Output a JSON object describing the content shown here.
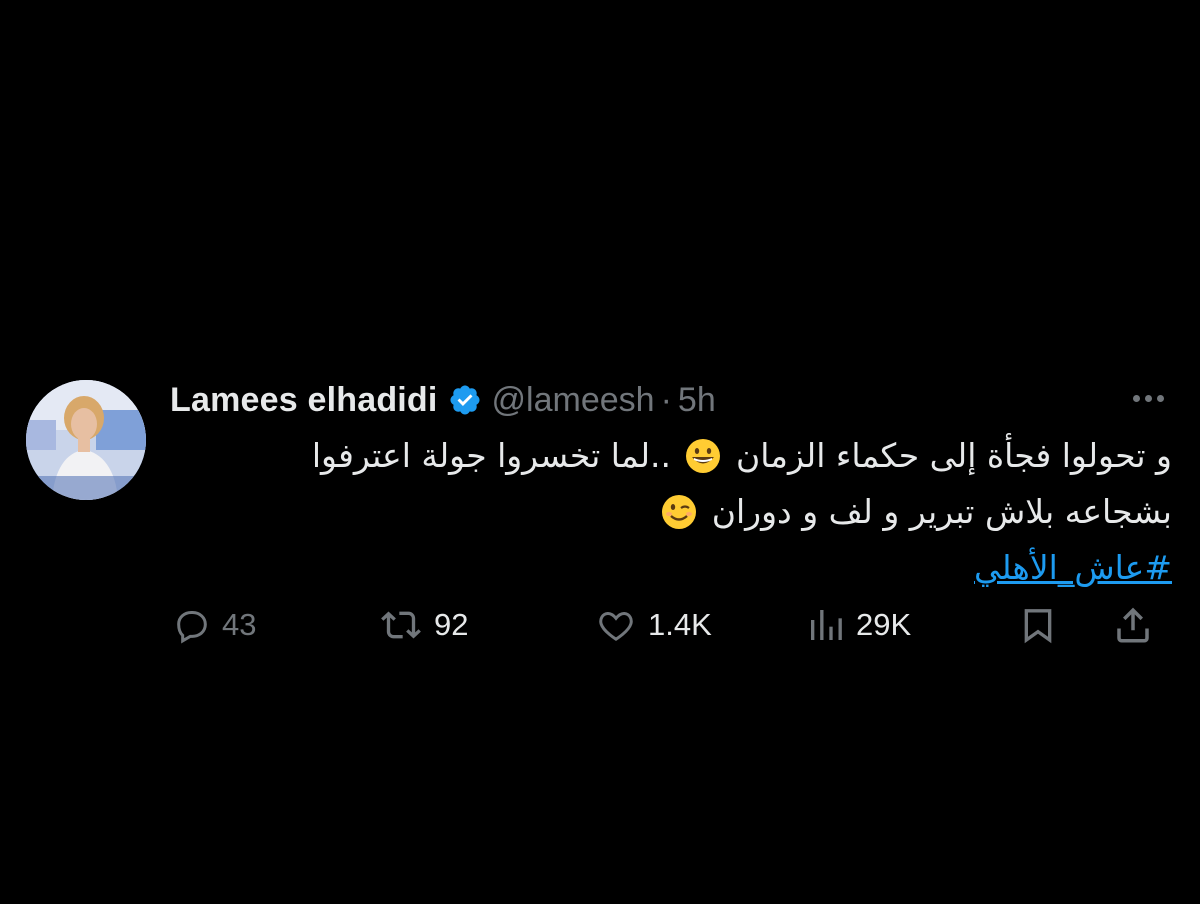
{
  "tweet": {
    "author_name": "Lamees elhadidi",
    "handle": "@lameesh",
    "separator": "·",
    "time": "5h",
    "text_line1": "و  تحولوا فجأة إلى حكماء الزمان",
    "text_line1_b": "..لما تخسروا جولة اعترفوا",
    "text_line2": "بشجاعه بلاش تبرير و لف و دوران",
    "hashtag": "#عاش_الأهلي"
  },
  "actions": {
    "replies": "43",
    "retweets": "92",
    "likes": "1.4K",
    "views": "29K"
  },
  "icons": {
    "verified": "verified-badge-icon",
    "more": "more-dots-icon",
    "reply": "reply-bubble-icon",
    "retweet": "retweet-arrows-icon",
    "like": "heart-icon",
    "views": "bar-chart-icon",
    "bookmark": "bookmark-icon",
    "share": "share-upload-icon",
    "emoji1": "grinning-face-emoji",
    "emoji2": "winking-face-emoji"
  },
  "colors": {
    "background": "#000000",
    "text": "#e7e9ea",
    "muted": "#71767b",
    "accent": "#1d9bf0"
  }
}
